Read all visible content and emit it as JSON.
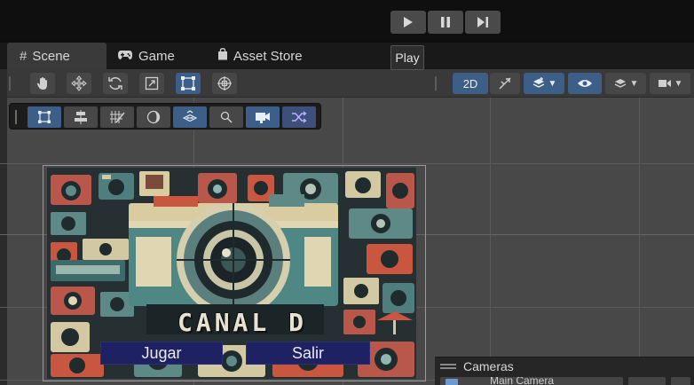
{
  "playbar": {
    "buttons": [
      "play-icon",
      "pause-icon",
      "step-icon"
    ]
  },
  "tabs": [
    {
      "label": "Scene",
      "icon": "grid-hash-icon",
      "active": true
    },
    {
      "label": "Game",
      "icon": "gamepad-icon",
      "active": false
    },
    {
      "label": "Asset Store",
      "icon": "shopping-bag-icon",
      "active": false
    }
  ],
  "tooltip": {
    "text": "Play"
  },
  "scene_toolbar": {
    "tools": [
      "hand-icon",
      "move-icon",
      "rotate-icon",
      "scale-icon",
      "rect-icon",
      "transform-icon"
    ],
    "selected_tool": "rect-icon",
    "mode_2d_label": "2D",
    "right_tools": [
      "lighting-toggle-icon",
      "gizmo-layers-icon",
      "visibility-icon",
      "layers-icon",
      "camera-icon"
    ]
  },
  "overlay_toolbar": {
    "tools": [
      "rect-select-icon",
      "align-icon",
      "grid-snap-icon",
      "shading-icon",
      "orientation-icon",
      "search-icon",
      "camera-preview-icon",
      "shuffle-icon"
    ]
  },
  "game_canvas": {
    "title_text": "CANAL D",
    "buttons": [
      {
        "label": "Jugar"
      },
      {
        "label": "Salir"
      }
    ]
  },
  "cameras_panel": {
    "title": "Cameras",
    "row_label": "Main Camera"
  },
  "colors": {
    "accent_blue": "#3d5f87",
    "scene_bg": "#484848",
    "button_navy": "#1f2262"
  }
}
